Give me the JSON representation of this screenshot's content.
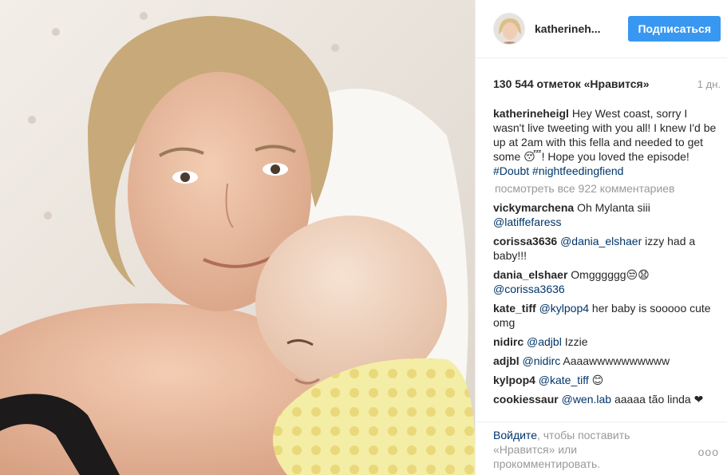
{
  "post": {
    "author": "katherineh...",
    "follow_label": "Подписаться",
    "likes": "130 544 отметок «Нравится»",
    "age": "1 дн.",
    "caption": {
      "user": "katherineheigl",
      "text": "Hey West coast, sorry I wasn't live tweeting with you all! I knew I'd be up at 2am with this fella and needed to get some 😴! Hope you loved the episode! ",
      "hashtags": "#Doubt #nightfeedingfiend"
    },
    "view_all": "посмотреть все 922 комментариев"
  },
  "comments": [
    {
      "user": "vickymarchena",
      "mention": "",
      "text": " Oh Mylanta siii ",
      "tail_mention": "@latiffefaress"
    },
    {
      "user": "corissa3636",
      "mention": " @dania_elshaer",
      "text": " izzy had a baby!!!",
      "tail_mention": ""
    },
    {
      "user": "dania_elshaer",
      "mention": "",
      "text": " Omgggggg😒😧 ",
      "tail_mention": "@corissa3636"
    },
    {
      "user": "kate_tiff",
      "mention": " @kylpop4",
      "text": " her baby is sooooo cute omg",
      "tail_mention": ""
    },
    {
      "user": "nidirc",
      "mention": " @adjbl",
      "text": " Izzie",
      "tail_mention": ""
    },
    {
      "user": "adjbl",
      "mention": " @nidirc",
      "text": " Aaaawwwwwwwwww",
      "tail_mention": ""
    },
    {
      "user": "kylpop4",
      "mention": " @kate_tiff",
      "text": " 😊",
      "tail_mention": ""
    },
    {
      "user": "cookiessaur",
      "mention": " @wen.lab",
      "text": " aaaaa tão linda ❤",
      "tail_mention": ""
    }
  ],
  "footer": {
    "login": "Войдите",
    "rest": ", чтобы поставить «Нравится» или прокомментировать.",
    "more": "ooo"
  },
  "colors": {
    "accent": "#3897f0",
    "link": "#003569",
    "muted": "#999999",
    "text": "#262626"
  }
}
